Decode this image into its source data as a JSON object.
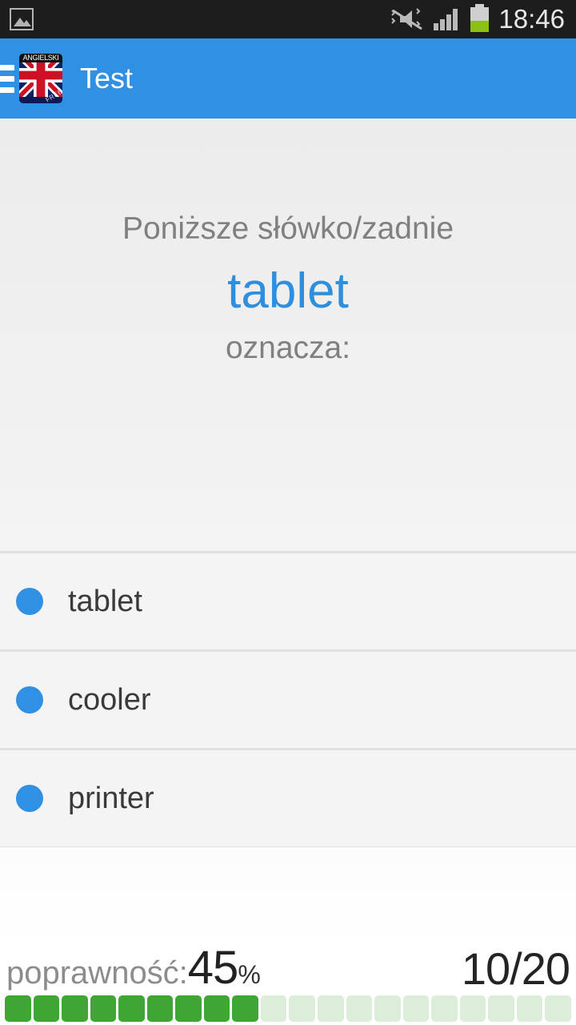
{
  "status_bar": {
    "notification_icon": "image-notification-icon",
    "vibrate_icon": "vibrate-mute-icon",
    "signal_icon": "signal-bars-icon",
    "battery_icon": "battery-icon",
    "battery_level_pct": 42,
    "clock": "18:46",
    "background_color": "#1d1d1d"
  },
  "app_bar": {
    "menu_icon": "hamburger-menu-icon",
    "app_icon": "angielski-flag-icon",
    "app_icon_top_label": "ANGIELSKI",
    "app_icon_badge": "FREE",
    "title": "Test",
    "background_color": "#3090e3",
    "title_color": "#ffffff"
  },
  "question": {
    "prompt": "Poniższe słówko/zadnie",
    "word": "tablet",
    "suffix": "oznacza:",
    "word_color": "#2f8fdd",
    "prompt_color": "#808080"
  },
  "options": [
    {
      "label": "tablet",
      "radio_icon": "radio-dot-icon",
      "selected": false
    },
    {
      "label": "cooler",
      "radio_icon": "radio-dot-icon",
      "selected": false
    },
    {
      "label": "printer",
      "radio_icon": "radio-dot-icon",
      "selected": false
    }
  ],
  "score": {
    "accuracy_label": "poprawność:",
    "accuracy_value": "45",
    "accuracy_unit": "%",
    "progress_counter": "10/20",
    "segments_total": 20,
    "segments_filled": 9,
    "segment_filled_color": "#3fa535",
    "segment_empty_color": "#dcedd9"
  }
}
